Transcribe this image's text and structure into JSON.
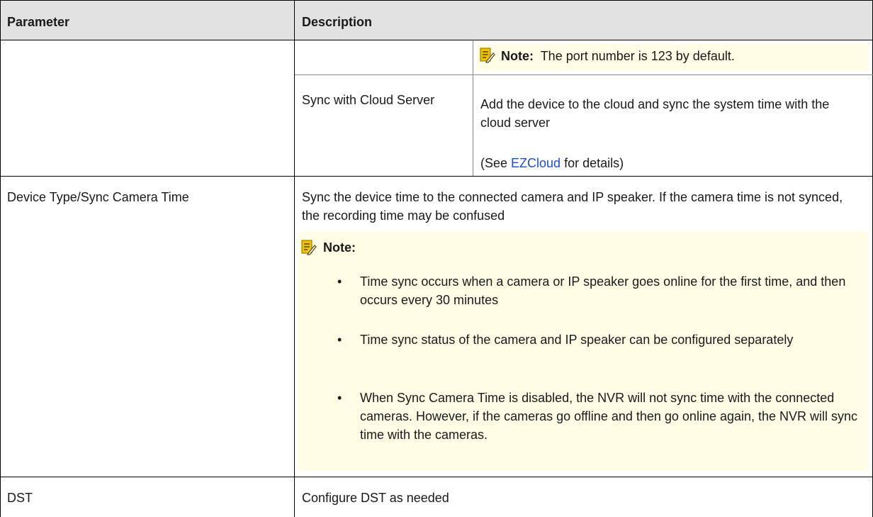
{
  "table": {
    "header": {
      "parameter": "Parameter",
      "description": "Description"
    },
    "row1": {
      "note_label": "Note:",
      "note_text": "The port number is 123 by default."
    },
    "row2": {
      "sub_parameter": "Sync with Cloud Server",
      "description": "Add the device to the cloud and sync the system time with the cloud server",
      "see_prefix": "(See ",
      "see_link": "EZCloud",
      "see_suffix": " for details)"
    },
    "row3": {
      "parameter": "Device Type/Sync Camera Time",
      "description": "Sync the device time to the connected camera and IP speaker. If the camera time is not synced, the recording time may be confused",
      "note_label": "Note:",
      "bullets": [
        "Time sync occurs when a camera or IP speaker goes online for the first time, and then occurs every 30 minutes",
        "Time sync status of the camera and IP speaker can be configured separately",
        "When Sync Camera Time is disabled, the NVR will not sync time with the connected cameras. However, if the cameras go offline and then go online again, the NVR will sync time with the cameras."
      ]
    },
    "row4": {
      "parameter": "DST",
      "description": "Configure DST as needed"
    }
  },
  "colors": {
    "header_bg": "#e2e2e2",
    "note_bg": "#fffde5",
    "note_icon": "#f2c400",
    "link": "#1b4fd8"
  },
  "icons": [
    "note-icon"
  ]
}
